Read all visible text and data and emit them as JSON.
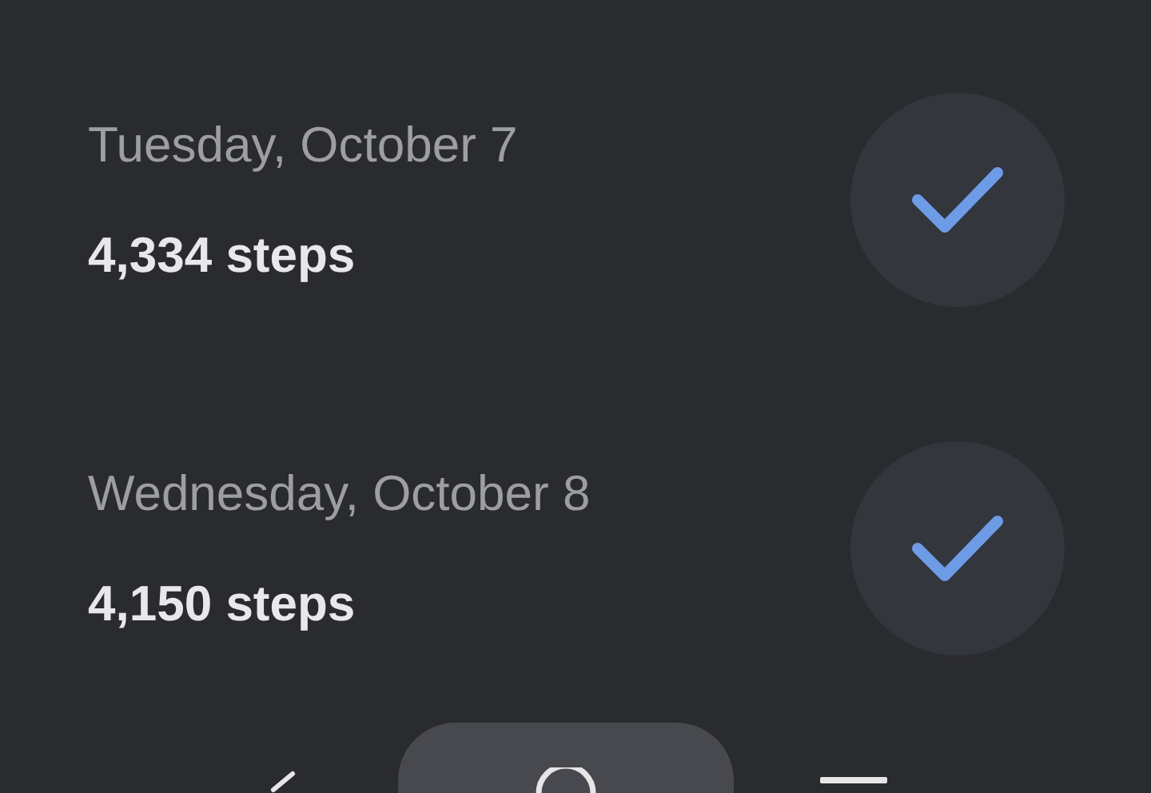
{
  "days": [
    {
      "date": "Tuesday, October 7",
      "steps": "4,334 steps",
      "checked": true
    },
    {
      "date": "Wednesday, October 8",
      "steps": "4,150 steps",
      "checked": true
    }
  ]
}
